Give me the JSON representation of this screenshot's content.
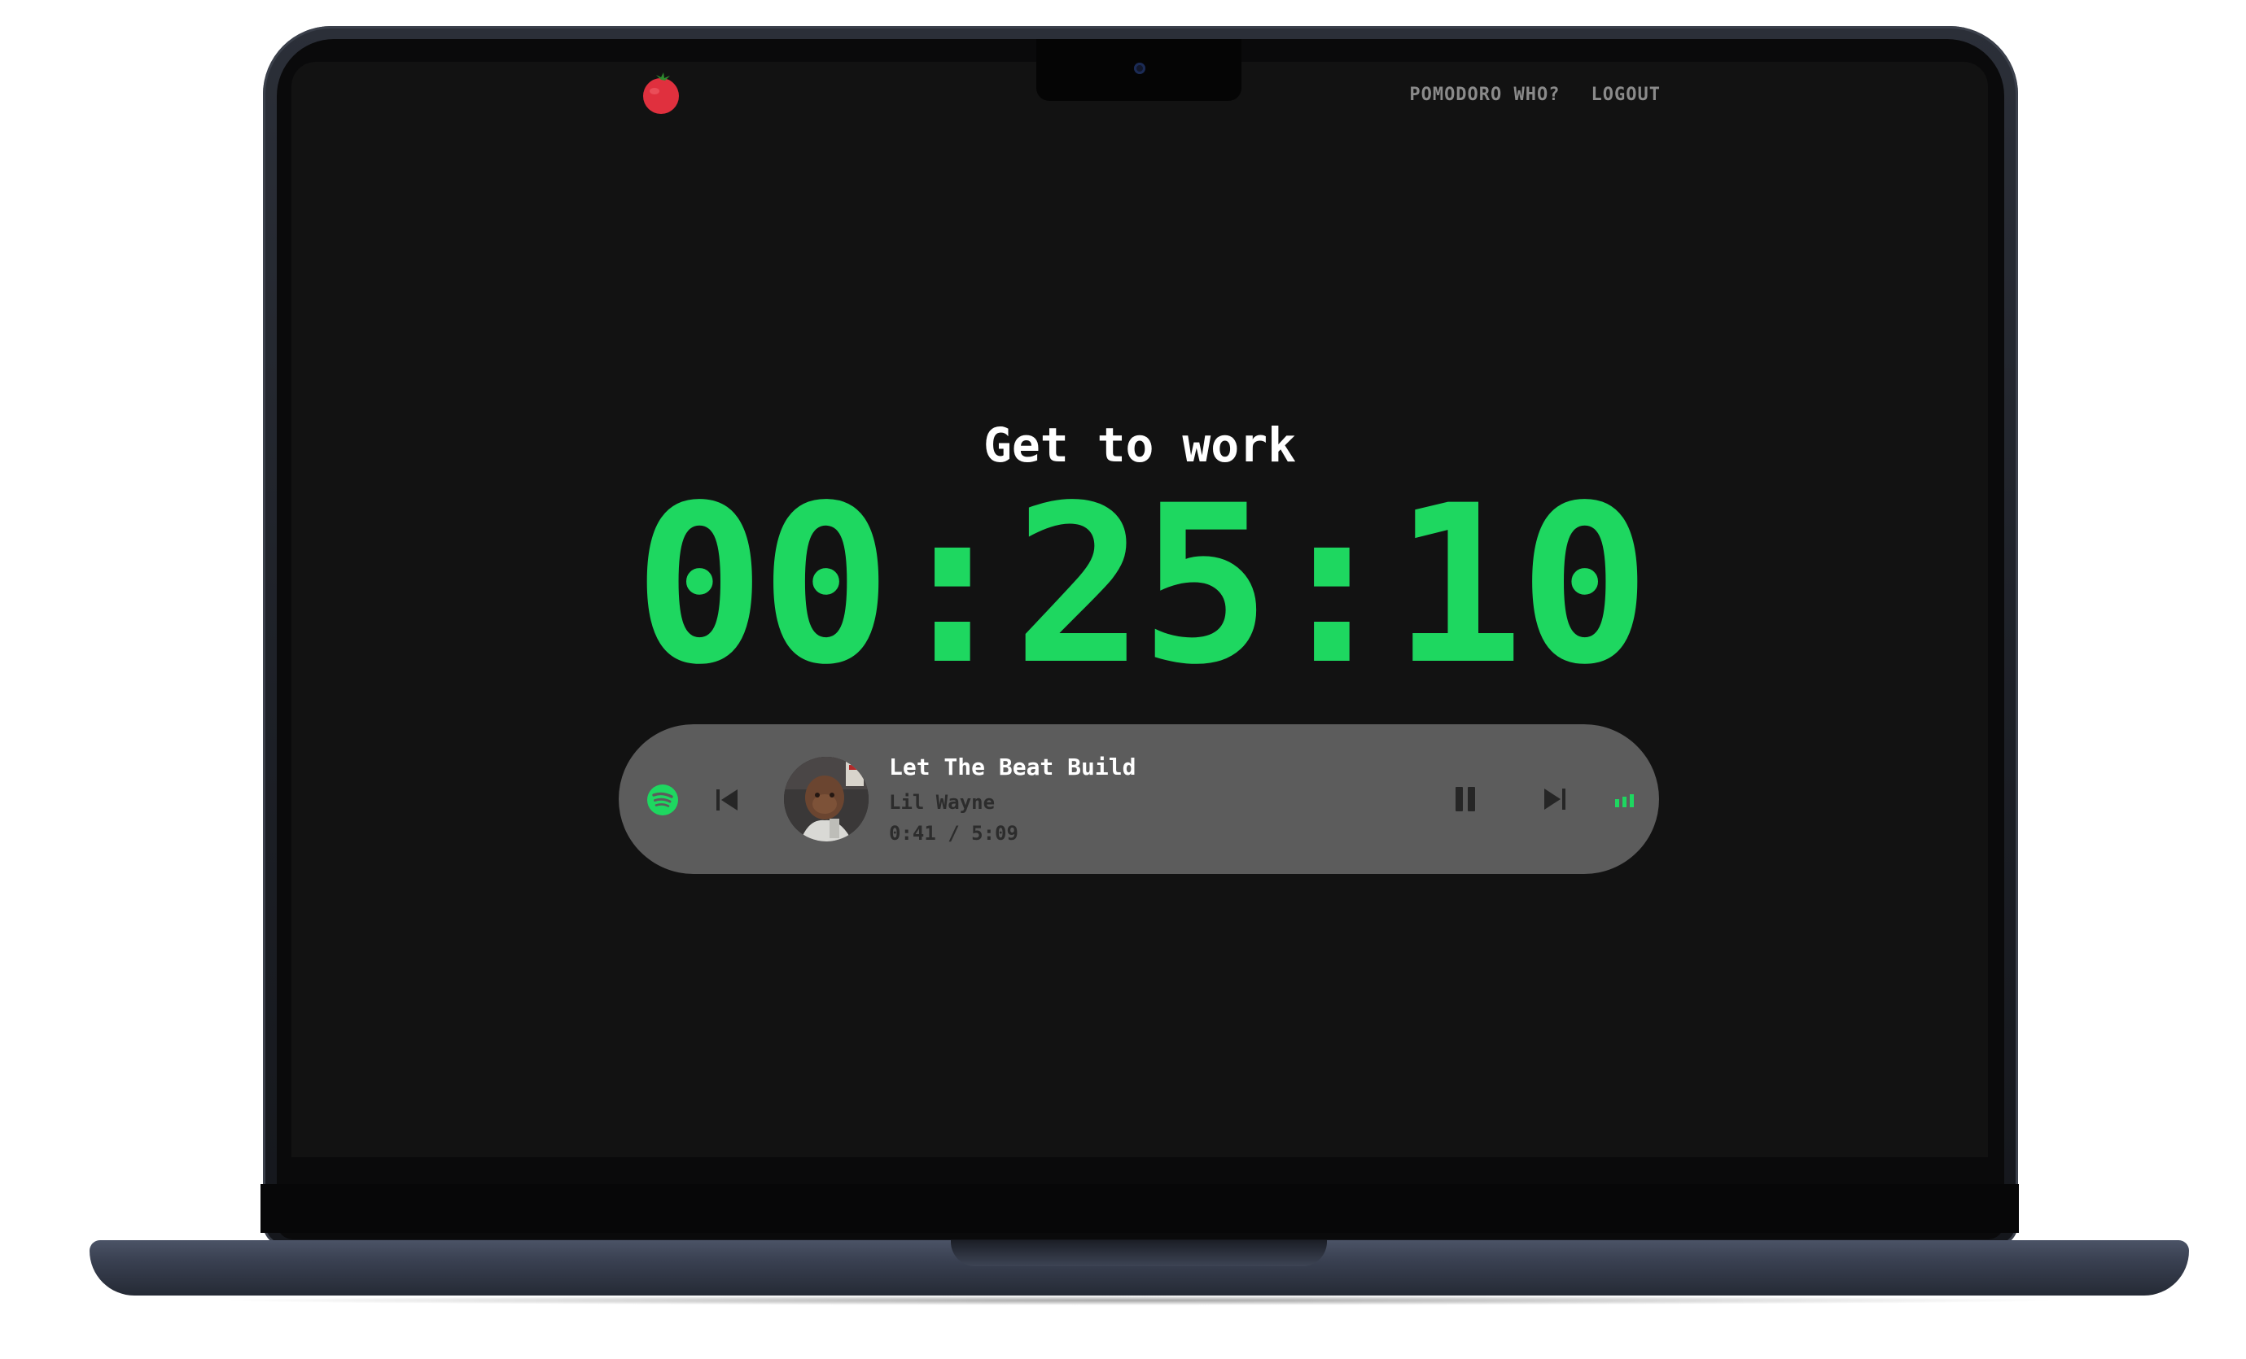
{
  "app": {
    "logo_icon": "tomato-icon",
    "nav": [
      {
        "label": "POMODORO WHO?"
      },
      {
        "label": "LOGOUT"
      }
    ]
  },
  "session": {
    "headline": "Get to work",
    "timer": "00:25:10",
    "accent_color": "#1ed760"
  },
  "player": {
    "provider_icon": "spotify-icon",
    "track_title": "Let The Beat Build",
    "artist": "Lil Wayne",
    "progress": "0:41 / 5:09",
    "state": "playing",
    "controls": [
      "previous-icon",
      "pause-icon",
      "next-icon",
      "audio-bars-icon"
    ]
  }
}
